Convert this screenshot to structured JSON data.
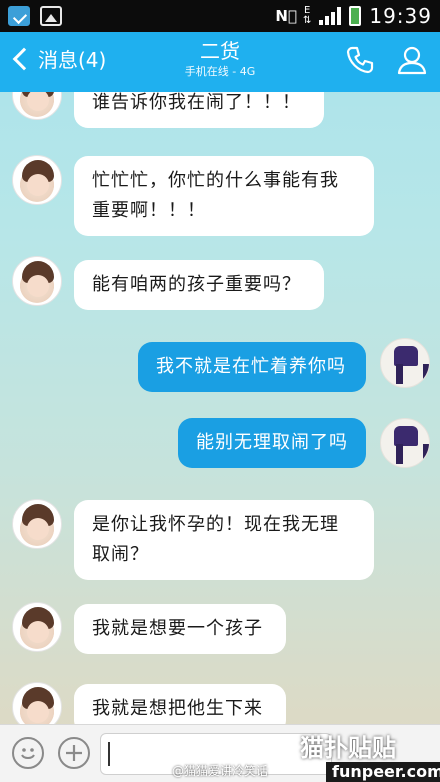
{
  "status_bar": {
    "network": "E",
    "time": "19:39"
  },
  "header": {
    "back_label": "消息(4)",
    "title": "二货",
    "subtitle": "手机在线 - 4G"
  },
  "messages": [
    {
      "side": "in",
      "text": "谁告诉你我在闹了！！！"
    },
    {
      "side": "in",
      "text": "忙忙忙，你忙的什么事能有我重要啊！！！"
    },
    {
      "side": "in",
      "text": "能有咱两的孩子重要吗？"
    },
    {
      "side": "out",
      "text": "我不就是在忙着养你吗"
    },
    {
      "side": "out",
      "text": "能别无理取闹了吗"
    },
    {
      "side": "in",
      "text": "是你让我怀孕的！现在我无理取闹？"
    },
    {
      "side": "in",
      "text": "我就是想要一个孩子"
    },
    {
      "side": "in",
      "text": "我就是想把他生下来"
    }
  ],
  "input": {
    "value": ""
  },
  "watermark": {
    "weibo": "@猫猫爱讲冷笑话",
    "brand": "猫扑贴贴",
    "site": "funpeer.com"
  },
  "colors": {
    "header": "#1fb0ef",
    "bubble_out": "#1a9fe3",
    "bubble_in": "#ffffff"
  }
}
